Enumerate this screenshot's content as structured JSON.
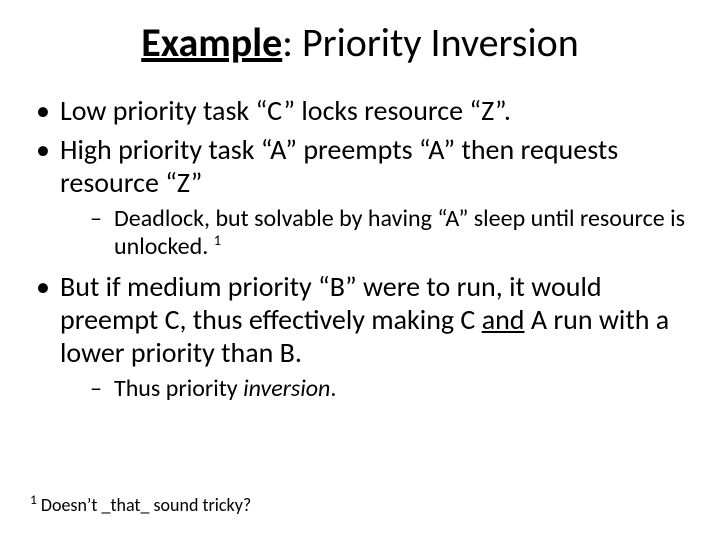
{
  "title": {
    "underlined": "Example",
    "rest": ": Priority Inversion"
  },
  "bullets": {
    "b1": "Low priority task “C” locks resource “Z”.",
    "b2": "High priority task “A” preempts “A” then requests resource “Z”",
    "b2_sub_a": "Deadlock, but solvable by having “A” sleep until resource is unlocked. ",
    "b2_sub_a_sup": "1",
    "b3_a": "But if medium priority “B” were to run, it would preempt C, thus effectively making C ",
    "b3_and": "and",
    "b3_b": " A run with a lower priority than B.",
    "b3_sub_a": "Thus priority ",
    "b3_sub_italic": "inversion",
    "b3_sub_end": "."
  },
  "footnote": {
    "sup": "1",
    "text": " Doesn’t _that_ sound tricky?"
  }
}
